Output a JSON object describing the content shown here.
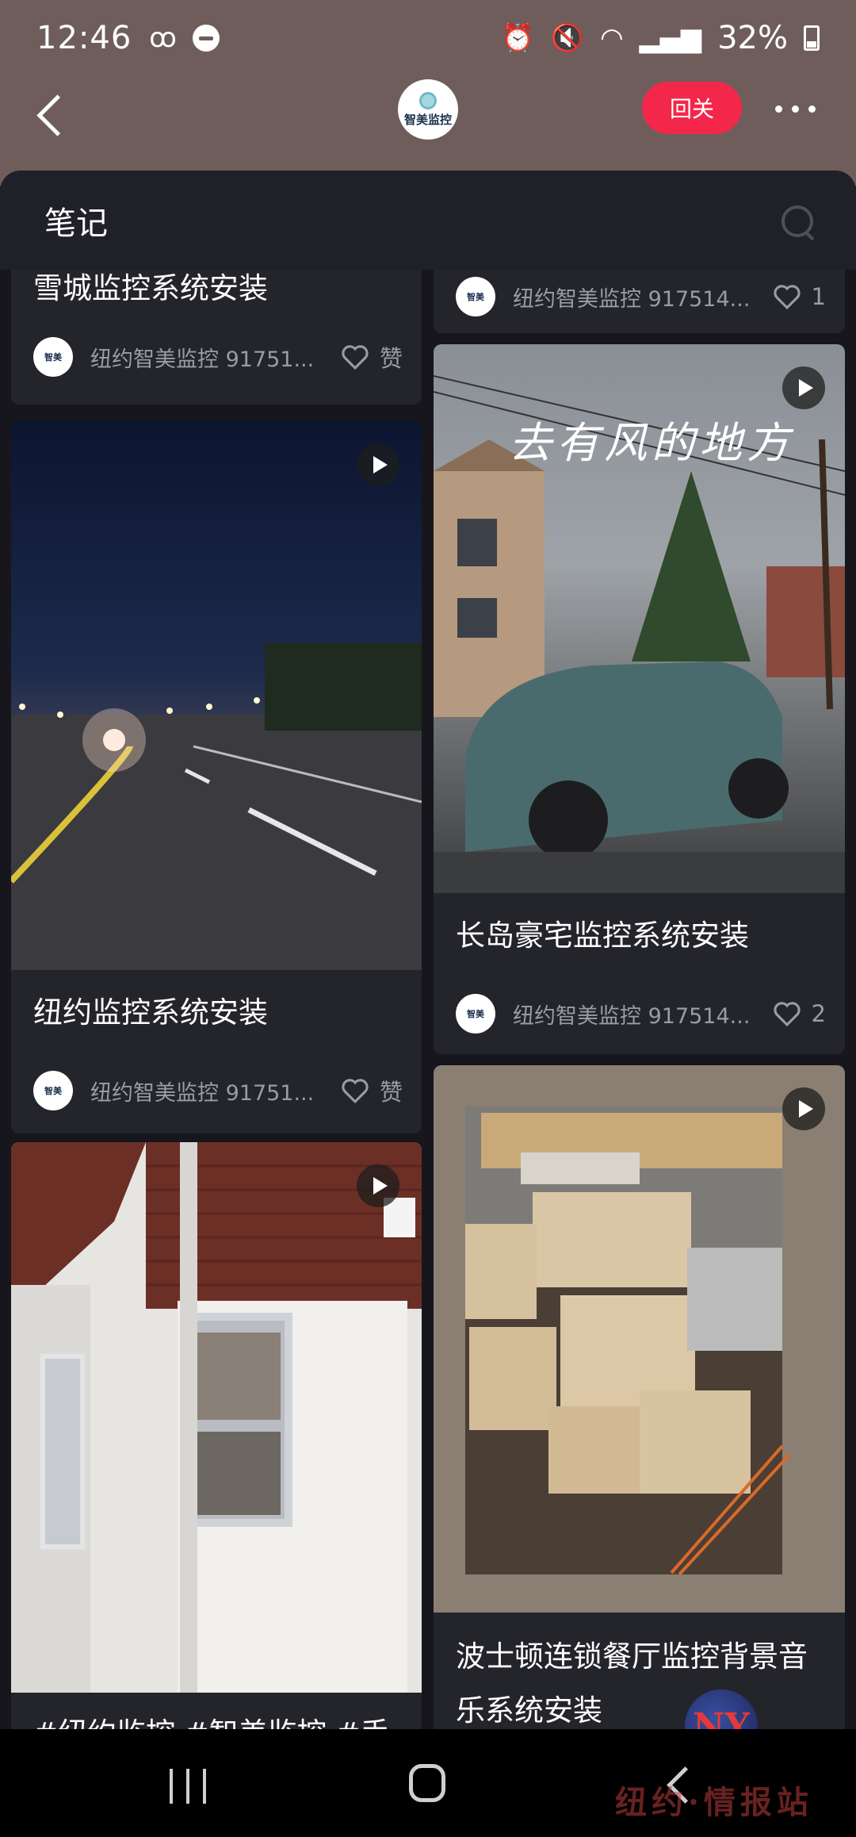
{
  "status_bar": {
    "time": "12:46",
    "battery": "32%"
  },
  "header": {
    "logo_text": "智美监控",
    "follow_back": "回关"
  },
  "panel": {
    "title": "笔记"
  },
  "cards": [
    {
      "title": "雪城监控系统安装",
      "author": "纽约智美监控 91751...",
      "likes": "赞"
    },
    {
      "title": "",
      "author": "纽约智美监控 917514...",
      "likes": "1"
    },
    {
      "title": "纽约监控系统安装",
      "author": "纽约智美监控 91751...",
      "likes": "赞"
    },
    {
      "title": "长岛豪宅监控系统安装",
      "author": "纽约智美监控 917514...",
      "likes": "2",
      "overlay_text": "去有风的地方"
    },
    {
      "title": "#纽约监控 #智美监控 #手"
    },
    {
      "title": "波士顿连锁餐厅监控背景音乐系统安装"
    }
  ],
  "watermark": {
    "text": "纽约·情报站",
    "logo": "NY"
  },
  "colors": {
    "header_bg": "#6f5d5c",
    "follow_button": "#f3274a",
    "feed_bg": "#16161c"
  }
}
